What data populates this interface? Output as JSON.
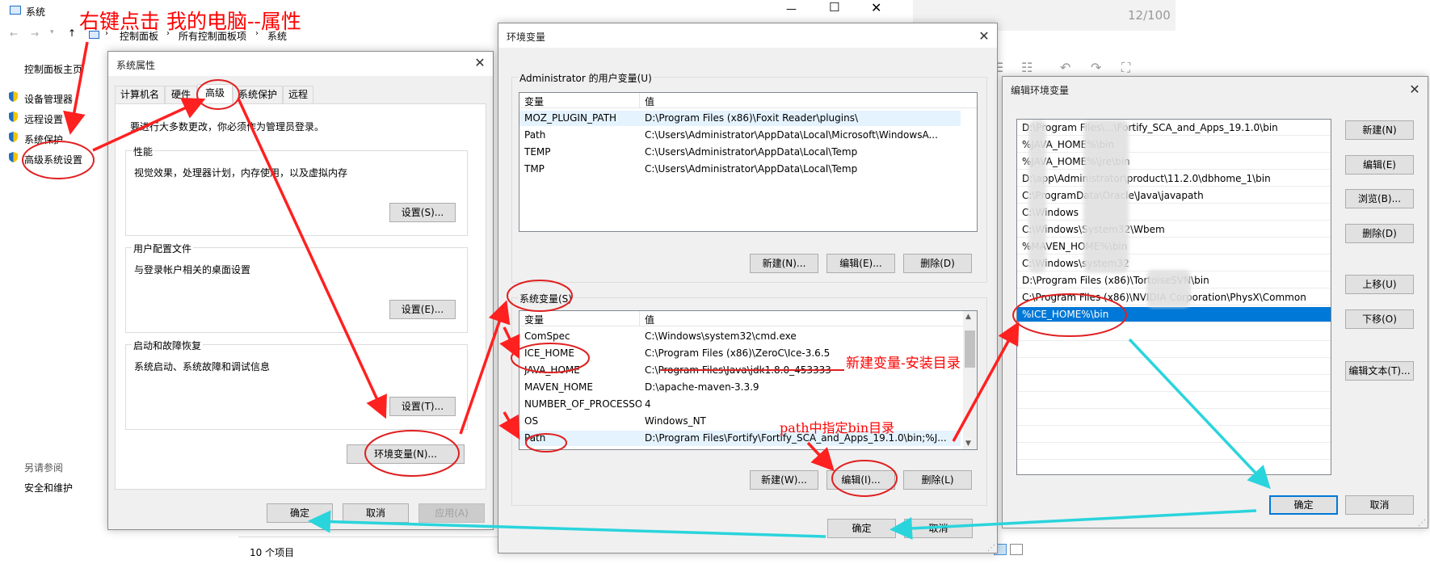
{
  "annotations": {
    "top_note": "右键点击 我的电脑--属性",
    "new_var_note": "新建变量-安装目录",
    "path_note": "path中指定bin目录"
  },
  "background_window": {
    "title": "系统",
    "counter": "12/100",
    "breadcrumb": [
      "控制面板",
      "所有控制面板项",
      "系统"
    ],
    "left_nav": {
      "home": "控制面板主页",
      "links": [
        "设备管理器",
        "远程设置",
        "系统保护",
        "高级系统设置"
      ],
      "see_also": "另请参阅",
      "see_also_links": [
        "安全和维护"
      ]
    },
    "status": "10 个项目"
  },
  "system_properties": {
    "title": "系统属性",
    "tabs": [
      "计算机名",
      "硬件",
      "高级",
      "系统保护",
      "远程"
    ],
    "active_tab": "高级",
    "admin_note": "要进行大多数更改，你必须作为管理员登录。",
    "sections": [
      {
        "title": "性能",
        "desc": "视觉效果，处理器计划，内存使用，以及虚拟内存",
        "button": "设置(S)..."
      },
      {
        "title": "用户配置文件",
        "desc": "与登录帐户相关的桌面设置",
        "button": "设置(E)..."
      },
      {
        "title": "启动和故障恢复",
        "desc": "系统启动、系统故障和调试信息",
        "button": "设置(T)..."
      }
    ],
    "env_button": "环境变量(N)...",
    "ok": "确定",
    "cancel": "取消",
    "apply": "应用(A)"
  },
  "env_vars": {
    "title": "环境变量",
    "user_group": "Administrator 的用户变量(U)",
    "col_var": "变量",
    "col_val": "值",
    "user_vars": [
      {
        "name": "MOZ_PLUGIN_PATH",
        "value": "D:\\Program Files (x86)\\Foxit Reader\\plugins\\"
      },
      {
        "name": "Path",
        "value": "C:\\Users\\Administrator\\AppData\\Local\\Microsoft\\WindowsA..."
      },
      {
        "name": "TEMP",
        "value": "C:\\Users\\Administrator\\AppData\\Local\\Temp"
      },
      {
        "name": "TMP",
        "value": "C:\\Users\\Administrator\\AppData\\Local\\Temp"
      }
    ],
    "user_buttons": [
      "新建(N)...",
      "编辑(E)...",
      "删除(D)"
    ],
    "sys_group": "系统变量(S)",
    "sys_vars": [
      {
        "name": "ComSpec",
        "value": "C:\\Windows\\system32\\cmd.exe"
      },
      {
        "name": "ICE_HOME",
        "value": "C:\\Program Files (x86)\\ZeroC\\Ice-3.6.5"
      },
      {
        "name": "JAVA_HOME",
        "value": "C:\\Program Files\\Java\\jdk1.8.0_453333"
      },
      {
        "name": "MAVEN_HOME",
        "value": "D:\\apache-maven-3.3.9"
      },
      {
        "name": "NUMBER_OF_PROCESSORS",
        "value": "4"
      },
      {
        "name": "OS",
        "value": "Windows_NT"
      },
      {
        "name": "Path",
        "value": "D:\\Program Files\\Fortify\\Fortify_SCA_and_Apps_19.1.0\\bin;%J..."
      }
    ],
    "sys_buttons": [
      "新建(W)...",
      "编辑(I)...",
      "删除(L)"
    ],
    "ok": "确定",
    "cancel": "取消"
  },
  "edit_env": {
    "title": "编辑环境变量",
    "entries": [
      "D:\\Program Files\\...\\Fortify_SCA_and_Apps_19.1.0\\bin",
      "%JAVA_HOME%\\bin",
      "%JAVA_HOME%\\jre\\bin",
      "D:\\app\\Administrator\\product\\11.2.0\\dbhome_1\\bin",
      "C:\\ProgramData\\Oracle\\Java\\javapath",
      "C:\\Windows",
      "C:\\Windows\\System32\\Wbem",
      "%MAVEN_HOME%\\bin",
      "C:\\Windows\\system32",
      "D:\\Program Files (x86)\\TortoiseSVN\\bin",
      "C:\\Program Files (x86)\\NVIDIA Corporation\\PhysX\\Common",
      "%ICE_HOME%\\bin"
    ],
    "selected_index": 11,
    "buttons": [
      "新建(N)",
      "编辑(E)",
      "浏览(B)...",
      "删除(D)",
      "上移(U)",
      "下移(O)",
      "编辑文本(T)..."
    ],
    "ok": "确定",
    "cancel": "取消"
  },
  "colors": {
    "accent": "#0078d7",
    "annotation_red": "#ff0000",
    "annotation_cyan": "#2ad4dc"
  }
}
